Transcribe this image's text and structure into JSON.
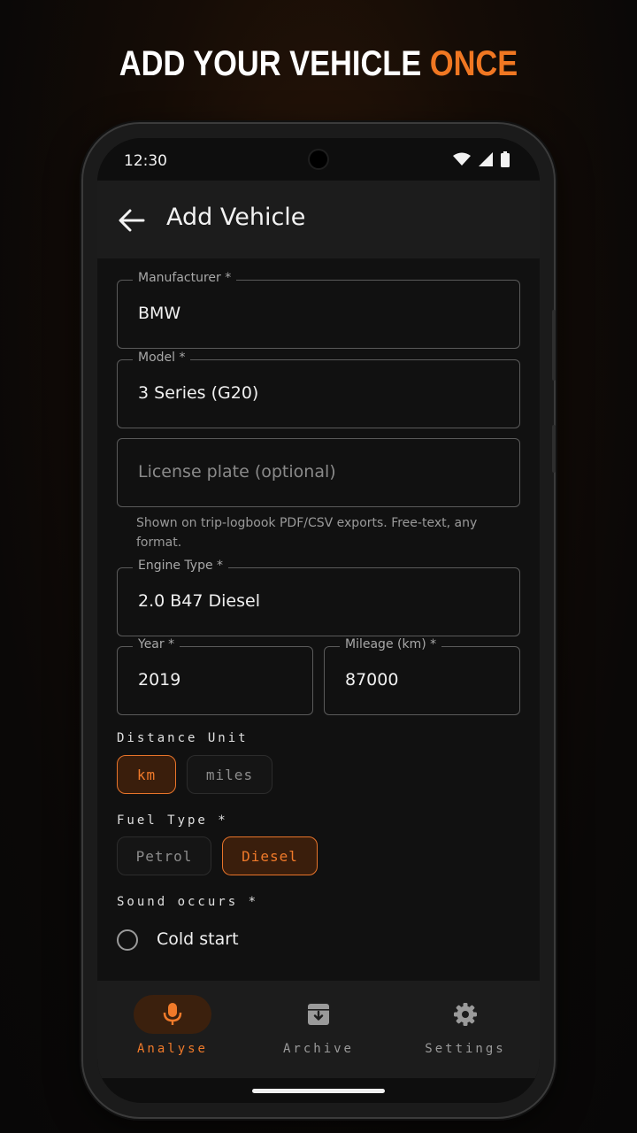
{
  "headline": {
    "prefix": "ADD YOUR VEHICLE",
    "accent": "ONCE"
  },
  "status_bar": {
    "time": "12:30",
    "icons": [
      "wifi-icon",
      "signal-icon",
      "battery-icon"
    ]
  },
  "app_bar": {
    "title": "Add Vehicle",
    "back_icon": "arrow-back-icon"
  },
  "form": {
    "manufacturer": {
      "label": "Manufacturer *",
      "value": "BMW"
    },
    "model": {
      "label": "Model *",
      "value": "3 Series (G20)"
    },
    "license_plate": {
      "placeholder": "License plate (optional)",
      "helper": "Shown on trip-logbook PDF/CSV exports. Free-text, any format."
    },
    "engine_type": {
      "label": "Engine Type *",
      "value": "2.0 B47 Diesel"
    },
    "year": {
      "label": "Year *",
      "value": "2019"
    },
    "mileage": {
      "label": "Mileage (km) *",
      "value": "87000"
    },
    "distance_unit": {
      "label": "Distance Unit",
      "options": [
        "km",
        "miles"
      ],
      "selected": "km"
    },
    "fuel_type": {
      "label": "Fuel Type *",
      "options": [
        "Petrol",
        "Diesel"
      ],
      "selected": "Diesel"
    },
    "sound_occurs": {
      "label": "Sound occurs *",
      "options": [
        "Cold start"
      ]
    }
  },
  "bottom_nav": {
    "items": [
      {
        "label": "Analyse",
        "icon": "microphone-icon",
        "active": true
      },
      {
        "label": "Archive",
        "icon": "archive-icon",
        "active": false
      },
      {
        "label": "Settings",
        "icon": "gear-icon",
        "active": false
      }
    ]
  },
  "colors": {
    "accent": "#f07722",
    "background": "#111111",
    "app_bar": "#1c1c1c",
    "selected_chip_bg": "#3a1e0c"
  }
}
